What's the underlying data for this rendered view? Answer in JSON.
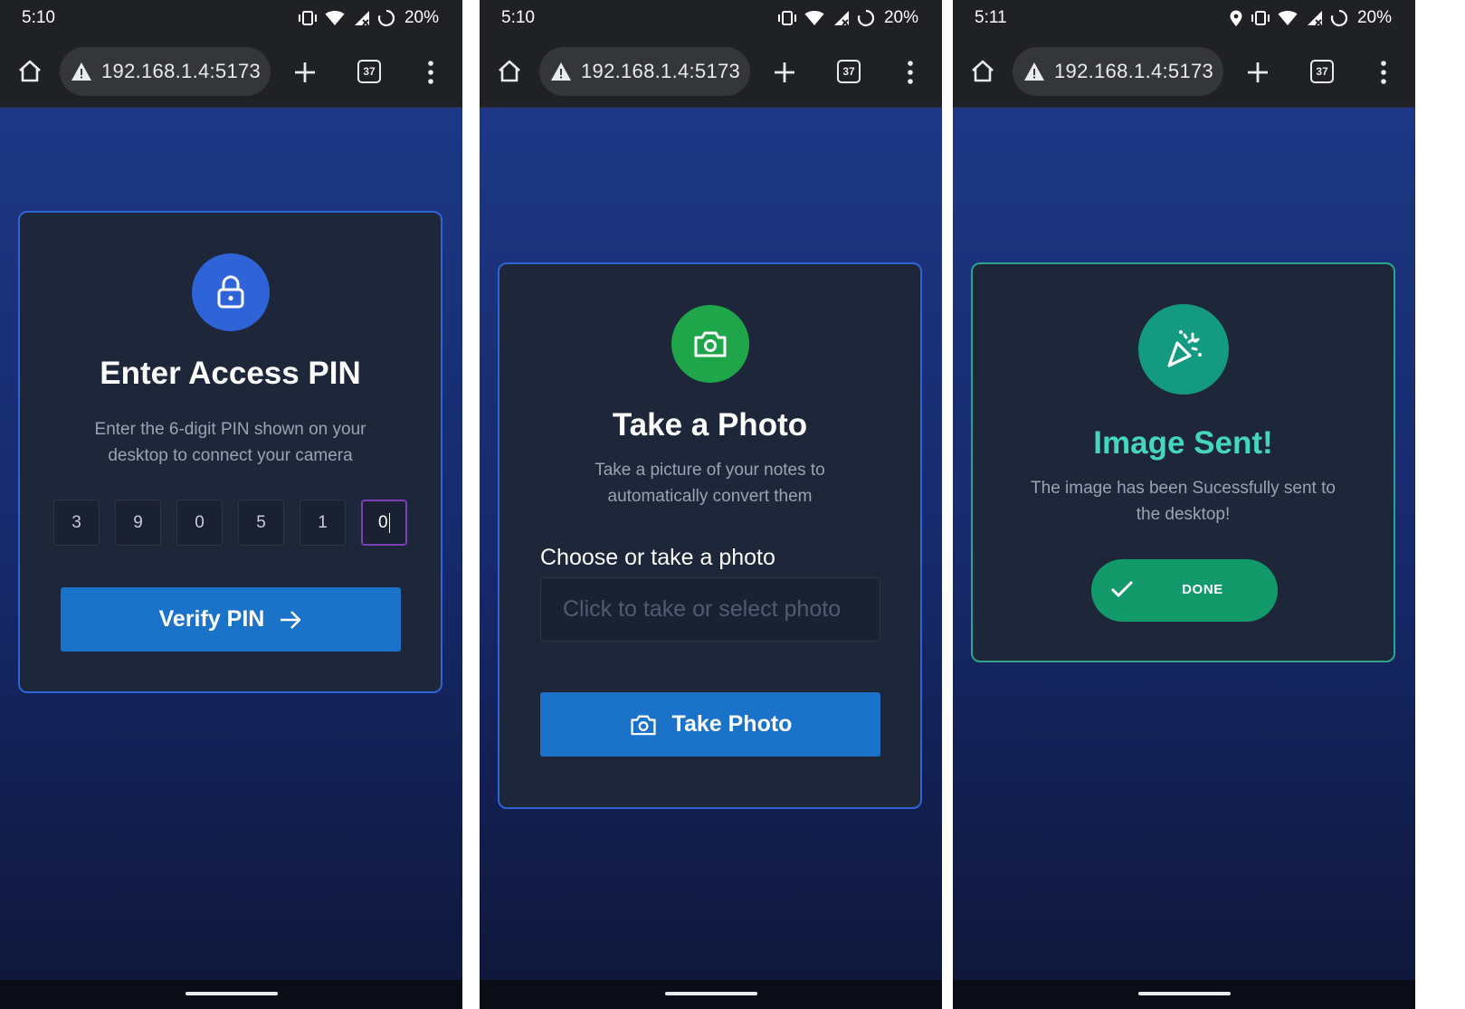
{
  "status_bars": [
    {
      "time": "5:10",
      "battery": "20%"
    },
    {
      "time": "5:10",
      "battery": "20%"
    },
    {
      "time": "5:11",
      "battery": "20%"
    }
  ],
  "browser": {
    "url": "192.168.1.4:5173",
    "tab_count": "37",
    "icons": [
      "home-icon",
      "warning-icon",
      "plus-icon",
      "tab-switcher-icon",
      "more-vert-icon"
    ]
  },
  "pin_screen": {
    "title": "Enter Access PIN",
    "subtitle_line1": "Enter the 6-digit PIN shown on your",
    "subtitle_line2": "desktop to connect your camera",
    "digits": [
      "3",
      "9",
      "0",
      "5",
      "1",
      "0"
    ],
    "verify_label": "Verify PIN",
    "icon": "lock-icon",
    "accent": "#2f63d8"
  },
  "photo_screen": {
    "title": "Take a Photo",
    "subtitle_line1": "Take a picture of your notes to",
    "subtitle_line2": "automatically convert them",
    "field_label": "Choose or take a photo",
    "field_placeholder": "Click to take or select photo",
    "take_photo_label": "Take Photo",
    "icon": "camera-icon",
    "accent": "#1fa54a"
  },
  "sent_screen": {
    "title": "Image Sent!",
    "subtitle_line1": "The image has been Sucessfully sent to",
    "subtitle_line2": "the desktop!",
    "done_label": "DONE",
    "icon": "party-popper-icon",
    "accent": "#139a80",
    "title_color": "#45d6c0"
  },
  "colors": {
    "primary_button": "#1a73c9",
    "card_bg": "#1e2639",
    "done_button": "#129a6b"
  }
}
